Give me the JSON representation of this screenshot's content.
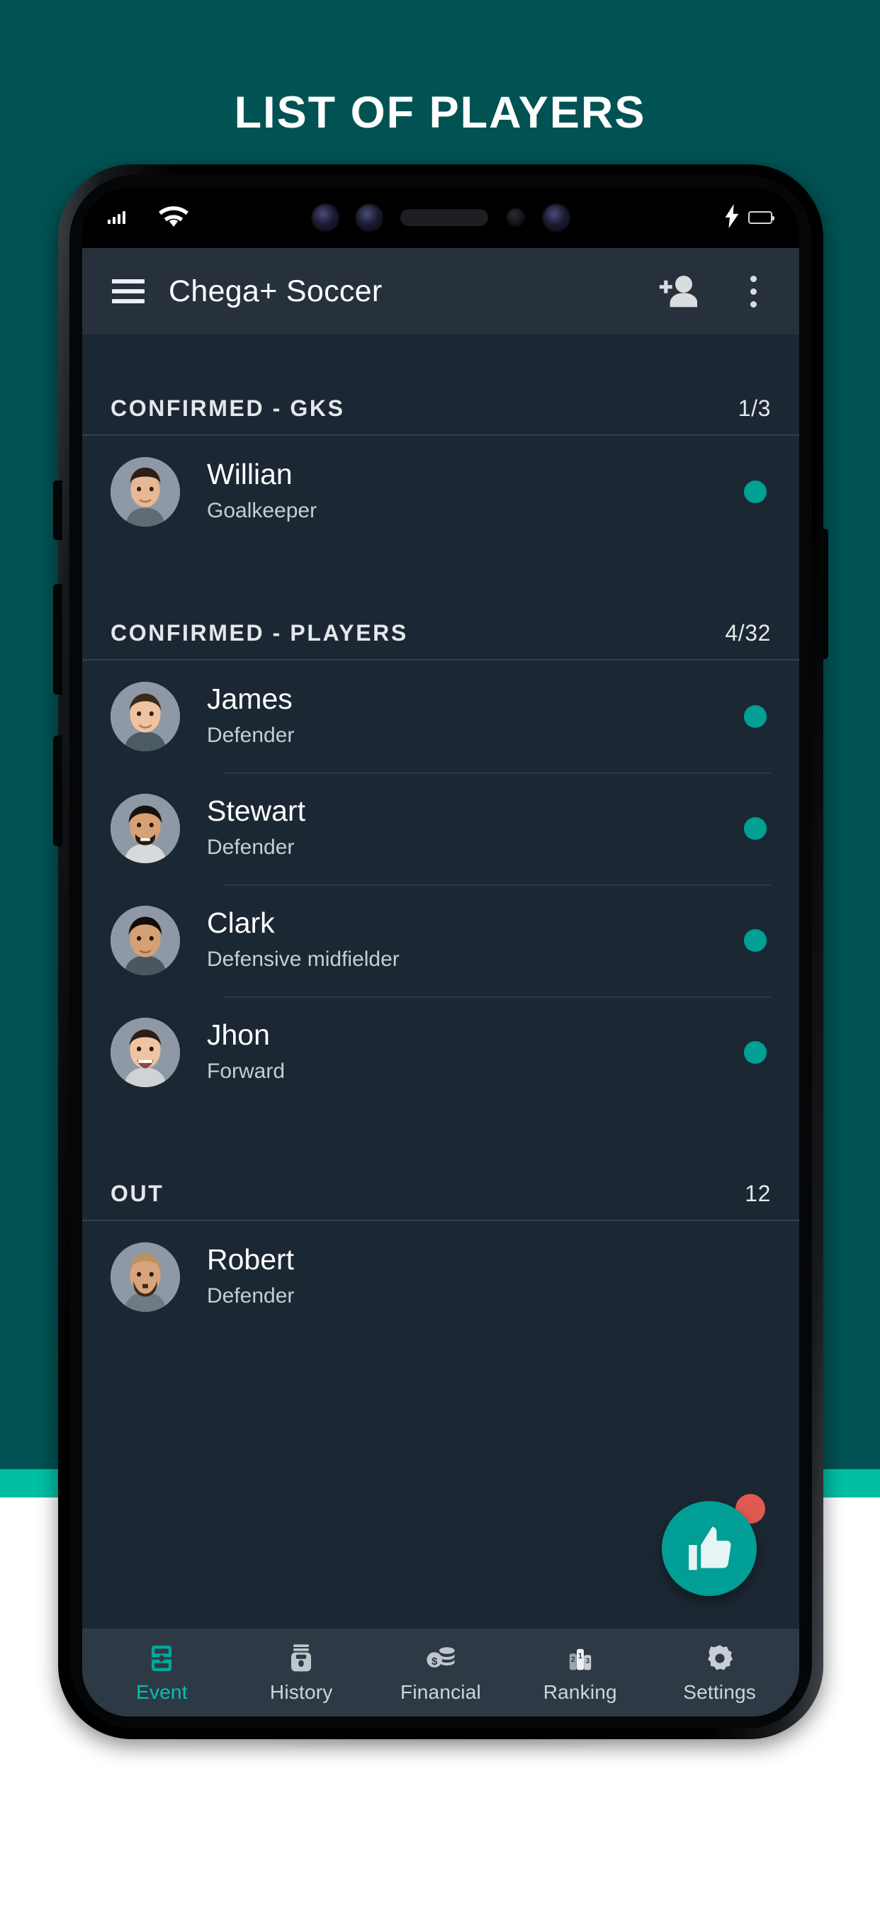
{
  "poster": {
    "title": "LIST OF PLAYERS",
    "background_color": "#005253",
    "accent_band_color": "#00bfa5",
    "base_color": "#ffffff"
  },
  "status_bar": {
    "signal_icon": "signal-bars-icon",
    "wifi_icon": "wifi-icon",
    "charging_icon": "charging-bolt-icon",
    "battery_icon": "battery-icon",
    "battery_color": "#44d62c"
  },
  "app_bar": {
    "menu_icon": "hamburger-menu-icon",
    "title": "Chega+ Soccer",
    "add_person_icon": "add-person-icon",
    "overflow_icon": "overflow-menu-icon",
    "background_color": "#26313c"
  },
  "sections": [
    {
      "id": "confirmed-gks",
      "title": "CONFIRMED - GKS",
      "count": "1/3",
      "players": [
        {
          "name": "Willian",
          "role": "Goalkeeper",
          "status": "confirmed",
          "status_color": "#00a093"
        }
      ]
    },
    {
      "id": "confirmed-players",
      "title": "CONFIRMED - PLAYERS",
      "count": "4/32",
      "players": [
        {
          "name": "James",
          "role": "Defender",
          "status": "confirmed",
          "status_color": "#00a093"
        },
        {
          "name": "Stewart",
          "role": "Defender",
          "status": "confirmed",
          "status_color": "#00a093"
        },
        {
          "name": "Clark",
          "role": "Defensive midfielder",
          "status": "confirmed",
          "status_color": "#00a093"
        },
        {
          "name": "Jhon",
          "role": "Forward",
          "status": "confirmed",
          "status_color": "#00a093"
        }
      ]
    },
    {
      "id": "out",
      "title": "OUT",
      "count": "12",
      "players": [
        {
          "name": "Robert",
          "role": "Defender",
          "status": "out",
          "status_color": ""
        }
      ]
    }
  ],
  "fab": {
    "icon": "thumbs-up-icon",
    "color": "#009e94",
    "badge_color": "#e05a52",
    "badge_icon": "notification-badge"
  },
  "bottom_nav": {
    "active_color": "#00c2b2",
    "items": [
      {
        "label": "Event",
        "icon": "event-icon",
        "active": true
      },
      {
        "label": "History",
        "icon": "history-icon",
        "active": false
      },
      {
        "label": "Financial",
        "icon": "financial-icon",
        "active": false
      },
      {
        "label": "Ranking",
        "icon": "ranking-icon",
        "active": false
      },
      {
        "label": "Settings",
        "icon": "settings-icon",
        "active": false
      }
    ]
  }
}
